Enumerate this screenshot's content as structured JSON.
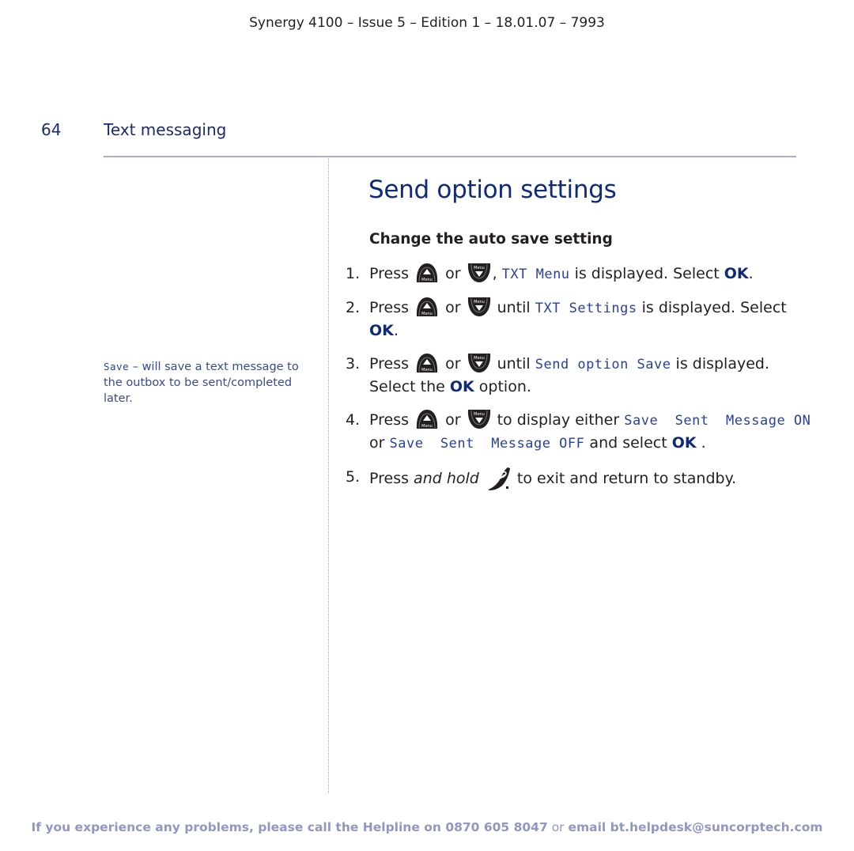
{
  "header": {
    "doc_info": "Synergy 4100 – Issue 5 – Edition 1 – 18.01.07 – 7993"
  },
  "section": {
    "page_number": "64",
    "title": "Text messaging"
  },
  "side_note": {
    "lcd_term": "Save",
    "text": " – will save a text message to the outbox to be sent/completed later."
  },
  "main": {
    "title": "Send option settings",
    "subheading": "Change the auto save setting",
    "icons": {
      "up_key": "up-menu-key-icon",
      "down_key": "down-menu-key-icon",
      "end_key": "end-call-key-icon",
      "key_label": "Menu"
    },
    "steps": [
      {
        "num": "1.",
        "press": "Press ",
        "or": " or ",
        "comma": ", ",
        "lcd": "TXT Menu",
        "after": " is displayed. Select ",
        "ok": "OK",
        "end": "."
      },
      {
        "num": "2.",
        "press": "Press ",
        "or": " or ",
        "until": " until ",
        "lcd": "TXT Settings",
        "after": " is displayed. Select ",
        "ok": "OK",
        "end": "."
      },
      {
        "num": "3.",
        "press": "Press ",
        "or": " or ",
        "until": " until ",
        "lcd": "Send option Save",
        "after": " is displayed. Select the ",
        "ok": "OK",
        "end": " option."
      },
      {
        "num": "4.",
        "press": "Press ",
        "or": " or ",
        "to_display": " to display either ",
        "lcd_on": "Save  Sent  Message ON",
        "or2": " or ",
        "lcd_off": "Save  Sent  Message OFF",
        "after": " and select ",
        "ok": "OK",
        "end": " ."
      },
      {
        "num": "5.",
        "press": "Press ",
        "and_hold": "and hold",
        "after": " to exit and return to standby."
      }
    ]
  },
  "footer": {
    "prefix": "If you experience any problems, please call the Helpline on ",
    "phone": "0870 605 8047",
    "or": " or ",
    "email_label": "email bt.helpdesk@suncorptech.com"
  }
}
